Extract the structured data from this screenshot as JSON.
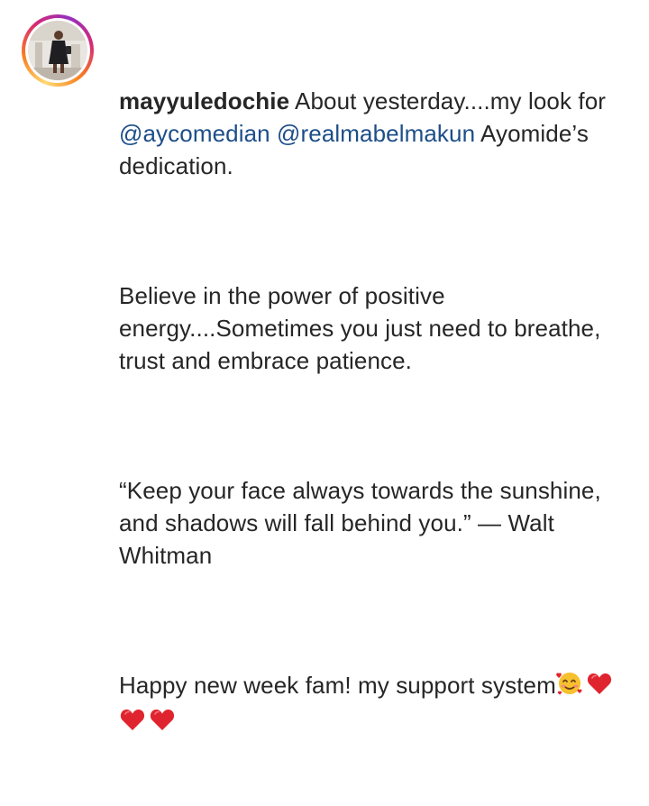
{
  "post": {
    "username": "mayyuledochie",
    "caption": {
      "p1_a": " About yesterday....my look for ",
      "mention1": "@aycomedian",
      "p1_sep": " ",
      "mention2": "@realmabelmakun",
      "p1_b": " Ayomide’s dedication.",
      "p2": "Believe in the power of positive energy....Sometimes you just need to breathe, trust and embrace patience.",
      "p3": "“Keep your face always towards the sunshine, and shadows will fall behind you.” — Walt Whitman",
      "p4": "Happy new week fam! my support system"
    },
    "emojis": [
      "smiling-face-with-hearts-icon",
      "red-heart-icon",
      "red-heart-icon",
      "red-heart-icon"
    ]
  },
  "colors": {
    "text": "#262626",
    "mention": "#1d4e89",
    "heart": "#e0242f",
    "emoji_face": "#f7c12e"
  }
}
